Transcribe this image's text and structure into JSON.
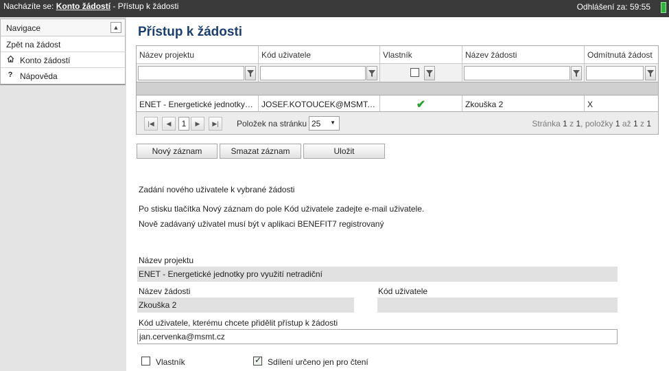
{
  "topbar": {
    "location_prefix": "Nacházíte se:",
    "location_link": "Konto žádostí",
    "location_suffix": " - Přístup k žádosti",
    "logout_label": "Odhlášení za:",
    "logout_time": "59:55",
    "indicator_color": "#2fb33a"
  },
  "sidebar": {
    "title": "Navigace",
    "items": [
      {
        "label": "Zpět na žádost",
        "icon": ""
      },
      {
        "label": "Konto žádostí",
        "icon": "home-icon"
      },
      {
        "label": "Nápověda",
        "icon": "question-icon"
      }
    ]
  },
  "main": {
    "title": "Přístup k žádosti",
    "grid": {
      "columns": [
        "Název projektu",
        "Kód uživatele",
        "Vlastník",
        "Název žádosti",
        "Odmítnutá žádost"
      ],
      "rows": [
        {
          "project": "ENET - Energetické jednotky p...",
          "user_code": "JOSEF.KOTOUCEK@MSMT.CZ",
          "owner": true,
          "request": "Zkouška 2",
          "rejected": "X"
        }
      ],
      "pager": {
        "page": "1",
        "page_size_label": "Položek na stránku",
        "page_size": "25",
        "info_prefix": "Stránka",
        "info_page": "1",
        "info_of": "z",
        "info_pages": "1",
        "info_items": ", položky",
        "info_from": "1",
        "info_to_word": "až",
        "info_to": "1",
        "info_of2": "z",
        "info_total": "1"
      }
    },
    "buttons": {
      "new": "Nový záznam",
      "delete": "Smazat záznam",
      "save": "Uložit"
    },
    "info": {
      "heading": "Zadání nového uživatele k vybrané žádosti",
      "line1": "Po stisku tlačítka Nový záznam do pole Kód uživatele zadejte e-mail uživatele.",
      "line2": "Nově zadávaný uživatel musí být v aplikaci BENEFIT7 registrovaný"
    },
    "form": {
      "project_label": "Název projektu",
      "project_value": "ENET - Energetické jednotky pro využití netradiční",
      "request_label": "Název žádosti",
      "request_value": "Zkouška 2",
      "user_code_label": "Kód uživatele",
      "user_code_value": "",
      "grant_label": "Kód uživatele, kterému chcete přidělit přístup k žádosti",
      "grant_value": "jan.cervenka@msmt.cz",
      "owner_label": "Vlastník",
      "owner_checked": false,
      "readonly_label": "Sdílení určeno jen pro čtení",
      "readonly_checked": true
    }
  },
  "colors": {
    "title": "#1c3f73",
    "topbar": "#3a3a3a",
    "checkmark": "#27a32b"
  }
}
